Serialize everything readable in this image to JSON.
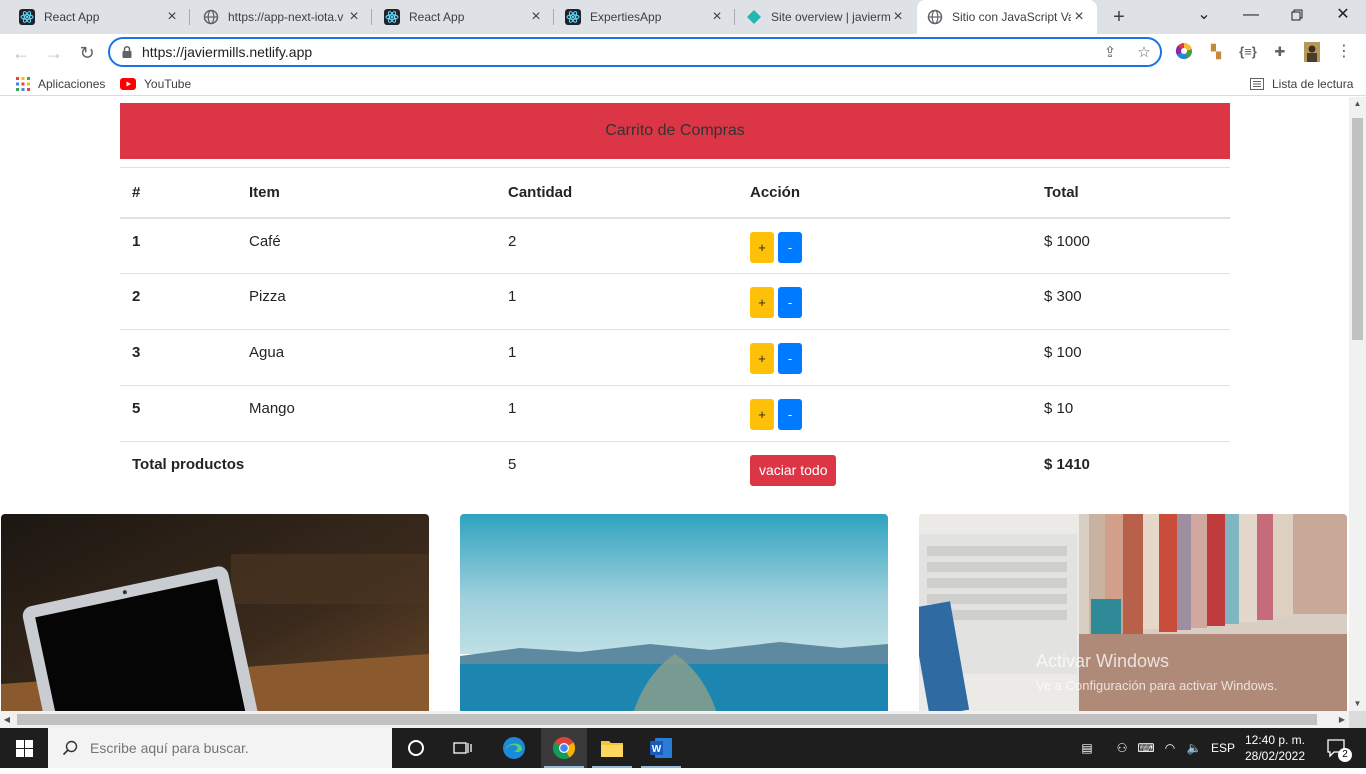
{
  "browser": {
    "tabs": [
      {
        "title": "React App",
        "icon": "react-icon"
      },
      {
        "title": "https://app-next-iota.v",
        "icon": "globe-icon"
      },
      {
        "title": "React App",
        "icon": "react-icon"
      },
      {
        "title": "ExpertiesApp",
        "icon": "react-icon"
      },
      {
        "title": "Site overview | javierm",
        "icon": "netlify-icon"
      },
      {
        "title": "Sitio con JavaScript Va",
        "icon": "globe-icon",
        "active": true
      }
    ],
    "address": "https://javiermills.netlify.app",
    "bookmarks": {
      "apps_label": "Aplicaciones",
      "youtube_label": "YouTube",
      "reading_list_label": "Lista de lectura"
    }
  },
  "page": {
    "banner_title": "Carrito de Compras",
    "table": {
      "headers": [
        "#",
        "Item",
        "Cantidad",
        "Acción",
        "Total"
      ],
      "rows": [
        {
          "id": "1",
          "item": "Café",
          "qty": "2",
          "total": "$ 1000"
        },
        {
          "id": "2",
          "item": "Pizza",
          "qty": "1",
          "total": "$ 300"
        },
        {
          "id": "3",
          "item": "Agua",
          "qty": "1",
          "total": "$ 100"
        },
        {
          "id": "5",
          "item": "Mango",
          "qty": "1",
          "total": "$ 10"
        }
      ],
      "plus_label": "+",
      "minus_label": "-",
      "footer": {
        "label": "Total productos",
        "qty": "5",
        "clear_label": "vaciar todo",
        "total": "$ 1410"
      }
    },
    "watermark": {
      "line1": "Activar Windows",
      "line2": "Ve a Configuración para activar Windows."
    }
  },
  "taskbar": {
    "search_placeholder": "Escribe aquí para buscar.",
    "language": "ESP",
    "time": "12:40 p. m.",
    "date": "28/02/2022",
    "notification_count": "2"
  },
  "colors": {
    "banner": "#dc3545",
    "plus_button": "#ffc107",
    "minus_button": "#007bff",
    "clear_button": "#dc3545",
    "focus_ring": "#1a73e8"
  }
}
